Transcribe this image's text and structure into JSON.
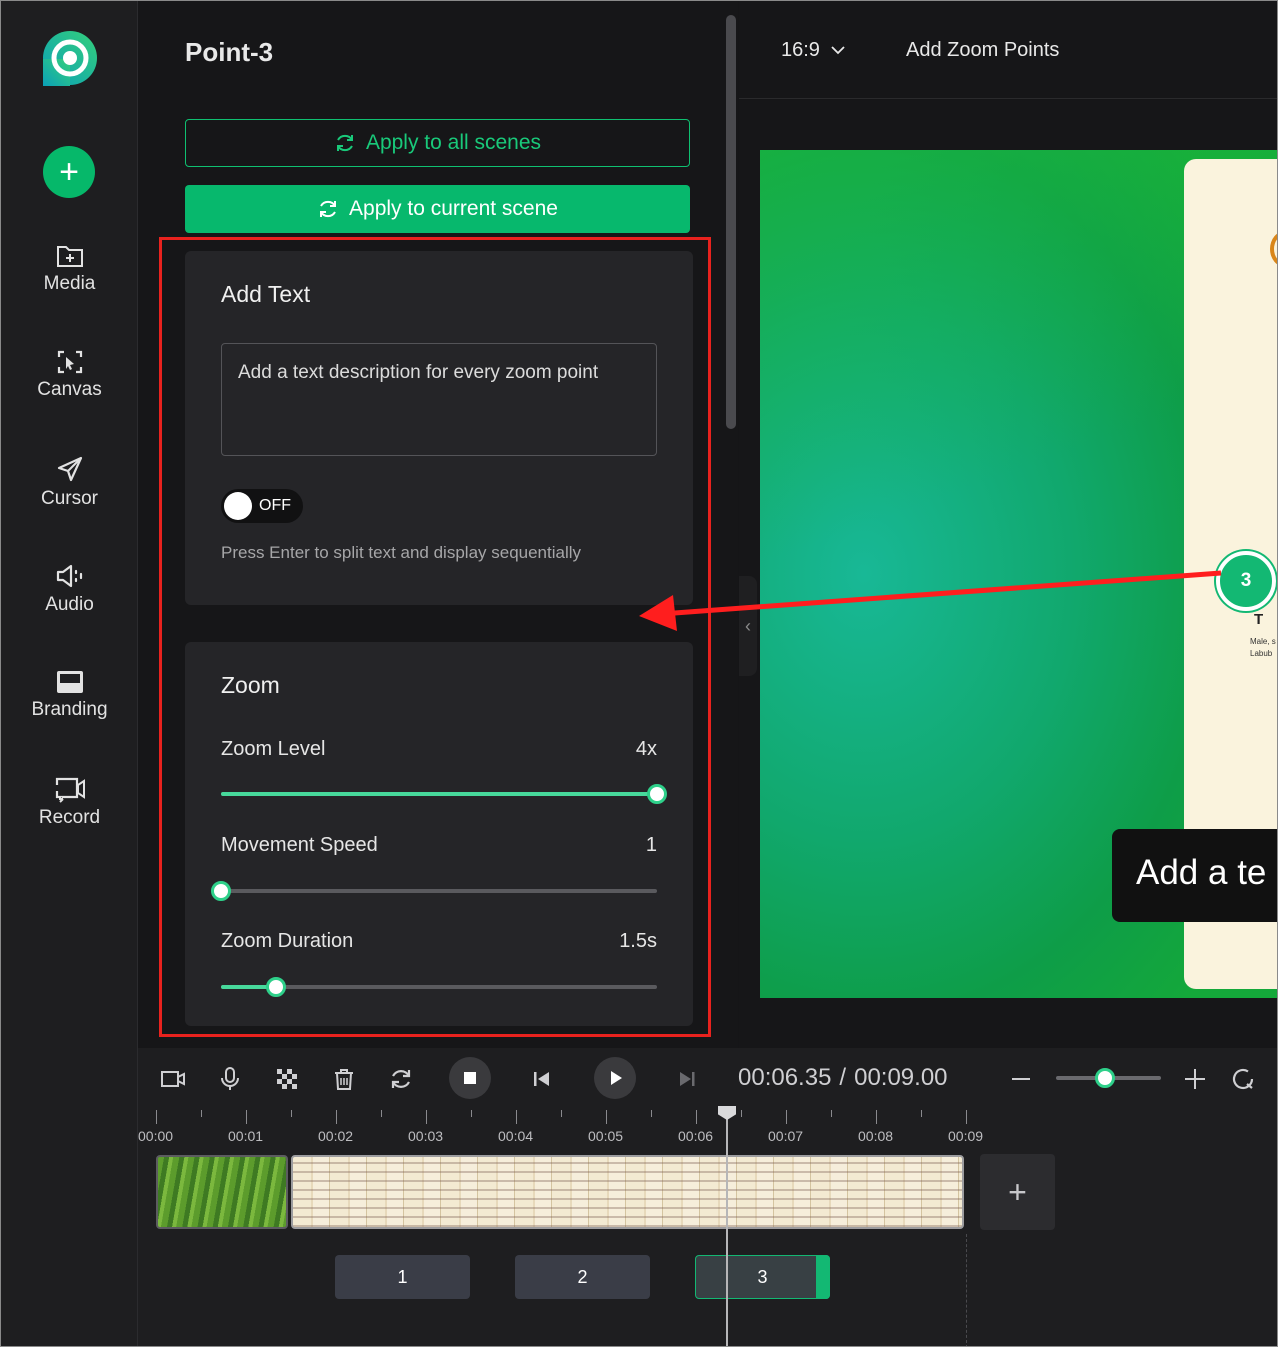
{
  "nav": {
    "items": [
      {
        "label": "Media",
        "icon": "media-folder-icon"
      },
      {
        "label": "Canvas",
        "icon": "canvas-icon"
      },
      {
        "label": "Cursor",
        "icon": "cursor-icon"
      },
      {
        "label": "Audio",
        "icon": "audio-speaker-icon"
      },
      {
        "label": "Branding",
        "icon": "branding-icon"
      },
      {
        "label": "Record",
        "icon": "record-icon"
      }
    ]
  },
  "panel": {
    "title": "Point-3",
    "apply_all_label": "Apply to all scenes",
    "apply_current_label": "Apply to current scene",
    "add_text": {
      "heading": "Add Text",
      "placeholder": "Add a text description for every zoom point",
      "toggle_state": "OFF",
      "hint": "Press Enter to split text and display sequentially"
    },
    "zoom": {
      "heading": "Zoom",
      "zoom_level_label": "Zoom Level",
      "zoom_level_value": "4x",
      "zoom_level_fraction": 1.0,
      "movement_speed_label": "Movement Speed",
      "movement_speed_value": "1",
      "movement_speed_fraction": 0.0,
      "zoom_duration_label": "Zoom Duration",
      "zoom_duration_value": "1.5s",
      "zoom_duration_fraction": 0.125
    }
  },
  "topbar": {
    "aspect_ratio": "16:9",
    "add_zoom_points_label": "Add Zoom Points"
  },
  "preview": {
    "marker_number": "3",
    "caption_text": "Add a te",
    "doc_letter": "T",
    "doc_snippet_1": "Male, s",
    "doc_snippet_2": "Labub"
  },
  "timeline": {
    "current_time": "00:06.35",
    "separator": "/",
    "total_time": "00:09.00",
    "ruler_labels": [
      "00:00",
      "00:01",
      "00:02",
      "00:03",
      "00:04",
      "00:05",
      "00:06",
      "00:07",
      "00:08",
      "00:09"
    ],
    "zoom_points": [
      "1",
      "2",
      "3"
    ],
    "timeline_zoom_fraction": 0.47
  },
  "colors": {
    "accent": "#07b86d",
    "highlight": "#e8221e",
    "slider_fill": "#47d99b"
  }
}
